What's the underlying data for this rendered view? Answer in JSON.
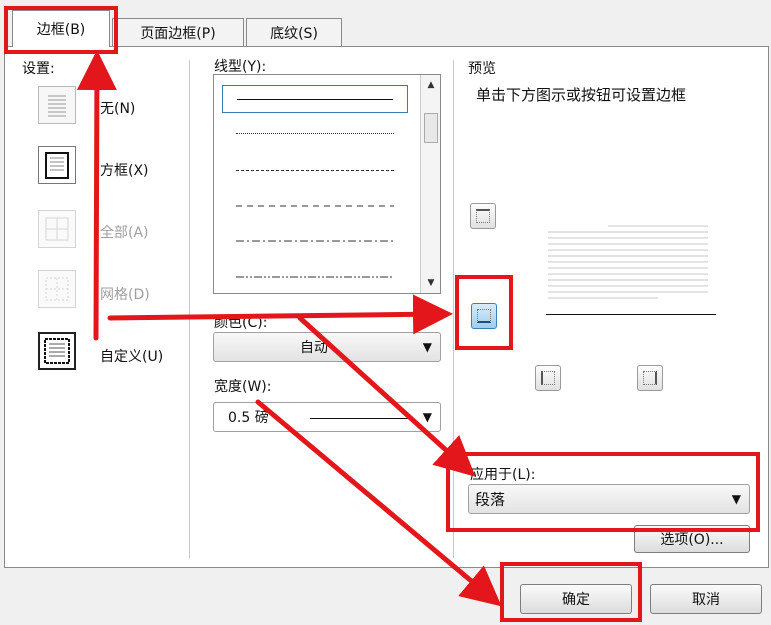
{
  "tabs": [
    {
      "label": "边框(B)"
    },
    {
      "label": "页面边框(P)"
    },
    {
      "label": "底纹(S)"
    }
  ],
  "settings": {
    "heading": "设置:",
    "items": [
      {
        "label": "无(N)",
        "enabled": true,
        "selected": false
      },
      {
        "label": "方框(X)",
        "enabled": true,
        "selected": false
      },
      {
        "label": "全部(A)",
        "enabled": false,
        "selected": false
      },
      {
        "label": "网格(D)",
        "enabled": false,
        "selected": false
      },
      {
        "label": "自定义(U)",
        "enabled": true,
        "selected": true
      }
    ]
  },
  "style": {
    "heading": "线型(Y):",
    "lines": [
      "solid",
      "dotted",
      "dashed",
      "wide-dashed",
      "dash-dot",
      "dash-dot-dot"
    ],
    "selected_index": 0
  },
  "color": {
    "heading": "颜色(C):",
    "value": "自动"
  },
  "width": {
    "heading": "宽度(W):",
    "value": "0.5 磅"
  },
  "preview": {
    "heading": "预览",
    "hint": "单击下方图示或按钮可设置边框"
  },
  "apply_to": {
    "heading": "应用于(L):",
    "value": "段落"
  },
  "options_button": "选项(O)...",
  "ok_button": "确定",
  "cancel_button": "取消",
  "colors": {
    "annotation": "#e3171b",
    "selected_blue": "#3c78b5"
  }
}
